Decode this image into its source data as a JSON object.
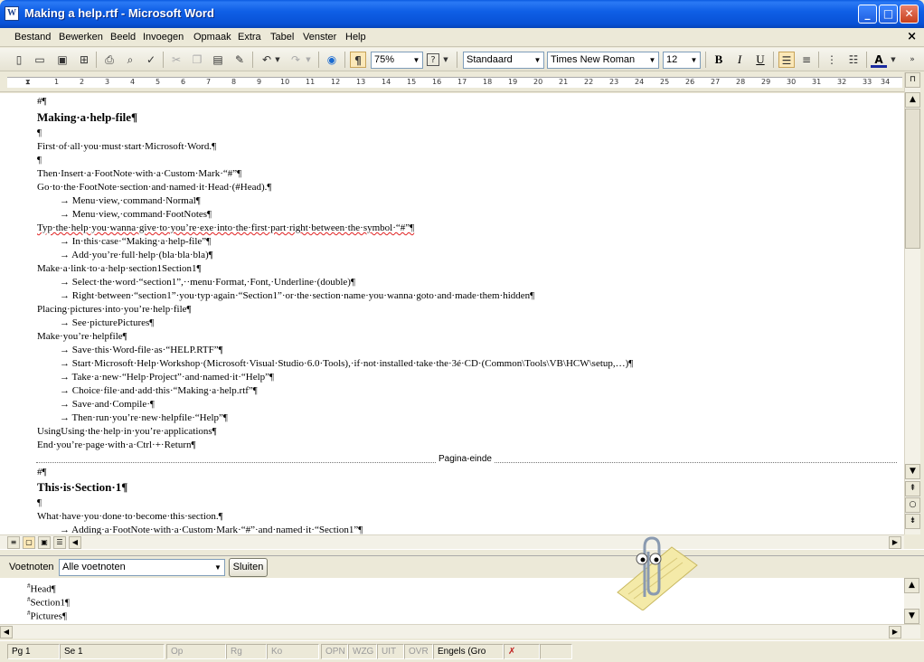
{
  "window": {
    "icon_letter": "W",
    "title": "Making a help.rtf - Microsoft Word",
    "minimize": "_",
    "maximize": "□",
    "close": "✕"
  },
  "menu": {
    "items": [
      "Bestand",
      "Bewerken",
      "Beeld",
      "Invoegen",
      "Opmaak",
      "Extra",
      "Tabel",
      "Venster",
      "Help"
    ],
    "doc_close": "×"
  },
  "toolbar": {
    "zoom": "75%",
    "style": "Standaard",
    "font": "Times New Roman",
    "size": "12",
    "bold": "B",
    "italic": "I",
    "underline": "U",
    "pilcrow": "¶",
    "help": "?",
    "font_color_letter": "A"
  },
  "ruler": {
    "ticks": [
      "1",
      "2",
      "3",
      "4",
      "5",
      "6",
      "7",
      "8",
      "9",
      "10",
      "11",
      "12",
      "13",
      "14",
      "15",
      "16",
      "17",
      "18",
      "19",
      "20",
      "21",
      "22",
      "23",
      "24",
      "25",
      "26",
      "27",
      "28",
      "29",
      "30",
      "31",
      "32",
      "33",
      "34"
    ]
  },
  "document": {
    "lines": [
      "#¶",
      "Making·a·help-file¶",
      "¶",
      "First·of·all·you·must·start·Microsoft·Word.¶",
      "¶",
      "Then·Insert·a·FootNote·with·a·Custom·Mark·“#”¶",
      "Go·to·the·FootNote·section·and·named·it·Head·(#Head).¶",
      "→ Menu·view,·command·Normal¶",
      "→ Menu·view,·command·FootNotes¶",
      "Typ·the·help·you·wanna·give·to·you’re·exe·into·the·first·part·right·between·the·symbol·“#”¶",
      "→ In·this·case·“Making·a·help-file”¶",
      "→ Add·you’re·full·help·(bla·bla·bla)¶",
      "Make·a·link·to·a·help·section1Section1¶",
      "→ Select·the·word·“section1”,··menu·Format,·Font,·Underline·(double)¶",
      "→ Right·between·“section1”·you·typ·again·“Section1”·or·the·section·name·you·wanna·goto·and·made·them·hidden¶",
      "Placing·pictures·into·you’re·help·file¶",
      "→ See·picturePictures¶",
      "Make·you’re·helpfile¶",
      "→ Save·this·Word-file·as·“HELP.RTF”¶",
      "→ Start·Microsoft·Help·Workshop·(Microsoft·Visual·Studio·6.0·Tools),·if·not·installed·take·the·3é·CD·(Common\\Tools\\VB\\HCW\\setup,…)¶",
      "→ Take·a·new·“Help·Project”·and·named·it·“Help”¶",
      "→ Choice·file·and·add·this·“Making·a·help.rtf”¶",
      "→ Save·and·Compile·¶",
      "→ Then·run·you’re·new·helpfile·“Help”¶",
      "UsingUsing·the·help·in·you’re·applications¶",
      "End·you’re·page·with·a·Ctrl·+·Return¶"
    ],
    "page_break_label": "Pagina-einde",
    "lines2": [
      "#¶",
      "This·is·Section·1¶",
      "¶",
      "What·have·you·done·to·become·this·section.¶",
      "→ Adding·a·FootNote·with·a·Custom·Mark·“#”·and·named·it·“Section1”¶"
    ]
  },
  "footnotes": {
    "label": "Voetnoten",
    "select": "Alle voetnoten",
    "close_button": "Sluiten",
    "marker": "#",
    "items": [
      "Head¶",
      "Section1¶",
      "Pictures¶"
    ]
  },
  "status": {
    "page": "Pg  1",
    "section": "Se  1",
    "at": "Op",
    "line": "Rg",
    "col": "Ko",
    "rec": "OPN",
    "trk": "WZG",
    "ext": "UIT",
    "ovr": "OVR",
    "language": "Engels (Gro"
  }
}
